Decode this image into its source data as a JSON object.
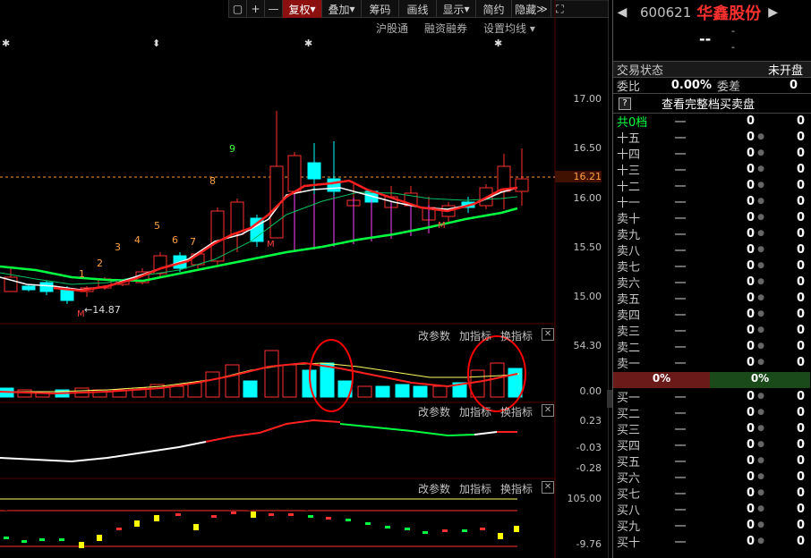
{
  "toolbar": {
    "items": [
      "复权",
      "叠加",
      "筹码",
      "画线",
      "显示",
      "简约",
      "隐藏"
    ]
  },
  "subbar": [
    "沪股通",
    "融资融券",
    "设置均线"
  ],
  "price_axis": [
    "17.00",
    "16.50",
    "16.21",
    "16.00",
    "15.50",
    "15.00"
  ],
  "low_label": "14.87",
  "wave_labels": [
    "1",
    "2",
    "3",
    "4",
    "5",
    "6",
    "7",
    "8",
    "9"
  ],
  "pane_buttons": {
    "p1": [
      "改参数",
      "加指标",
      "换指标"
    ],
    "p2": [
      "改参数",
      "加指标",
      "换指标"
    ],
    "p3": [
      "改参数",
      "加指标",
      "换指标"
    ]
  },
  "vol_axis": [
    "54.30",
    "0.00"
  ],
  "macd_axis": [
    "0.23",
    "-0.03",
    "-0.28"
  ],
  "ind_axis": [
    "105.00",
    "-9.76"
  ],
  "stock": {
    "code": "600621",
    "name": "华鑫股份",
    "price": "--",
    "dash1": "-",
    "dash2": "-"
  },
  "status": {
    "label": "交易状态",
    "value": "未开盘"
  },
  "ratio": {
    "label1": "委比",
    "value1": "0.00%",
    "label2": "委差",
    "value2": "0"
  },
  "full_book": "查看完整档买卖盘",
  "total_levels": {
    "label": "共0档",
    "p": "一",
    "v": "0",
    "v2": "0"
  },
  "sell_levels": [
    "十五",
    "十四",
    "十三",
    "十二",
    "十一",
    "卖十",
    "卖九",
    "卖八",
    "卖七",
    "卖六",
    "卖五",
    "卖四",
    "卖三",
    "卖二",
    "卖一"
  ],
  "buy_levels": [
    "买一",
    "买二",
    "买三",
    "买四",
    "买五",
    "买六",
    "买七",
    "买八",
    "买九",
    "买十"
  ],
  "level_price": "一",
  "level_vol": "0",
  "split": {
    "left": "0%",
    "right": "0%"
  },
  "colors": {
    "up": "#ff3030",
    "down": "#00ffff",
    "ma_white": "#ffffff",
    "ma_green": "#00ff40",
    "accent_red": "#8c1010"
  }
}
